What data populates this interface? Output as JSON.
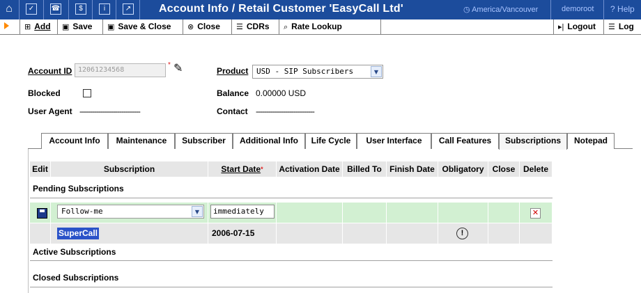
{
  "titlebar": {
    "title": "Account Info / Retail Customer 'EasyCall Ltd'",
    "timezone": "America/Vancouver",
    "user": "demoroot",
    "help": "Help",
    "icons": [
      "home-icon",
      "checkbox-icon",
      "phone-icon",
      "dollar-icon",
      "info-icon",
      "chart-icon"
    ]
  },
  "toolbar": {
    "add": "Add",
    "save": "Save",
    "save_close": "Save & Close",
    "close": "Close",
    "cdrs": "CDRs",
    "rate_lookup": "Rate Lookup",
    "logout": "Logout",
    "log": "Log"
  },
  "account": {
    "id_label": "Account ID",
    "id_value": "12061234568",
    "product_label": "Product",
    "product_value": "USD - SIP Subscribers",
    "blocked_label": "Blocked",
    "balance_label": "Balance",
    "balance_value": "0.00000 USD",
    "user_agent_label": "User Agent",
    "user_agent_value": "-----------------------------",
    "contact_label": "Contact",
    "contact_value": "----------------------------"
  },
  "tabs": [
    "Account Info",
    "Maintenance",
    "Subscriber",
    "Additional Info",
    "Life Cycle",
    "User Interface",
    "Call Features",
    "Subscriptions",
    "Notepad"
  ],
  "active_tab": "Subscriptions",
  "table": {
    "headers": {
      "edit": "Edit",
      "subscription": "Subscription",
      "start_date": "Start Date",
      "activation_date": "Activation Date",
      "billed_to": "Billed To",
      "finish_date": "Finish Date",
      "obligatory": "Obligatory",
      "close": "Close",
      "delete": "Delete"
    },
    "pending_label": "Pending Subscriptions",
    "new_row": {
      "subscription_select": "Follow-me",
      "start_date_input": "immediately"
    },
    "existing_row": {
      "subscription": "SuperCall",
      "start_date": "2006-07-15"
    },
    "active_label": "Active Subscriptions",
    "closed_label": "Closed Subscriptions"
  },
  "colors": {
    "titlebar": "#1c4c9c",
    "row_green": "#d2f0d2",
    "selected_link": "#2a52c8"
  }
}
